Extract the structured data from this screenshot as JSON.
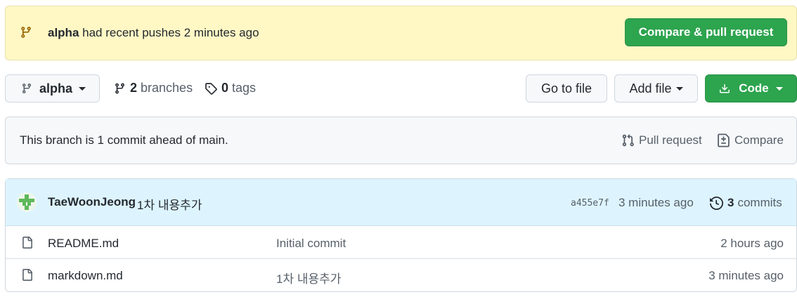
{
  "banner": {
    "branch": "alpha",
    "message": "had recent pushes 2 minutes ago",
    "button_label": "Compare & pull request"
  },
  "toolbar": {
    "branch_label": "alpha",
    "branches_count": "2",
    "branches_word": "branches",
    "tags_count": "0",
    "tags_word": "tags",
    "go_to_file": "Go to file",
    "add_file": "Add file",
    "code": "Code"
  },
  "ahead": {
    "message": "This branch is 1 commit ahead of main.",
    "pull_request": "Pull request",
    "compare": "Compare"
  },
  "latest_commit": {
    "author": "TaeWoonJeong",
    "message": "1차 내용추가",
    "sha": "a455e7f",
    "time": "3 minutes ago",
    "commits_count": "3",
    "commits_word": "commits"
  },
  "files": [
    {
      "name": "README.md",
      "message": "Initial commit",
      "time": "2 hours ago"
    },
    {
      "name": "markdown.md",
      "message": "1차 내용추가",
      "time": "3 minutes ago"
    }
  ],
  "colors": {
    "banner_bg": "#fff8c5",
    "green": "#2da44e",
    "commit_row_bg": "#ddf4ff",
    "muted": "#57606a"
  }
}
